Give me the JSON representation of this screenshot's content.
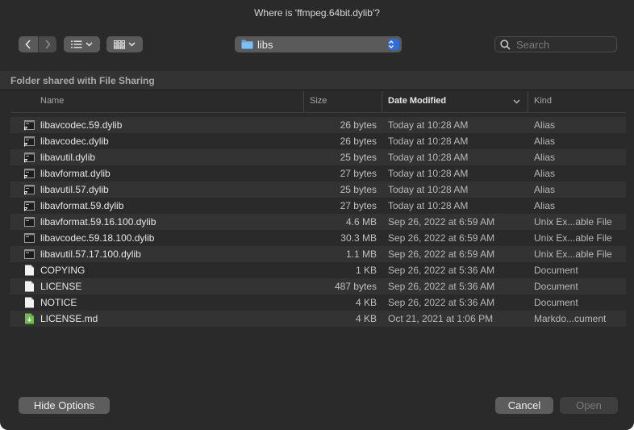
{
  "title": "Where is 'ffmpeg.64bit.dylib'?",
  "toolbar": {
    "folder_name": "libs",
    "search_placeholder": "Search"
  },
  "section_label": "Folder shared with File Sharing",
  "columns": {
    "name": "Name",
    "size": "Size",
    "date": "Date Modified",
    "kind": "Kind"
  },
  "files": [
    {
      "name": "libavcodec.59.dylib",
      "size": "26 bytes",
      "date": "Today at 10:28 AM",
      "kind": "Alias",
      "icon": "alias-exec-icon"
    },
    {
      "name": "libavcodec.dylib",
      "size": "26 bytes",
      "date": "Today at 10:28 AM",
      "kind": "Alias",
      "icon": "alias-exec-icon"
    },
    {
      "name": "libavutil.dylib",
      "size": "25 bytes",
      "date": "Today at 10:28 AM",
      "kind": "Alias",
      "icon": "alias-exec-icon"
    },
    {
      "name": "libavformat.dylib",
      "size": "27 bytes",
      "date": "Today at 10:28 AM",
      "kind": "Alias",
      "icon": "alias-exec-icon"
    },
    {
      "name": "libavutil.57.dylib",
      "size": "25 bytes",
      "date": "Today at 10:28 AM",
      "kind": "Alias",
      "icon": "alias-exec-icon"
    },
    {
      "name": "libavformat.59.dylib",
      "size": "27 bytes",
      "date": "Today at 10:28 AM",
      "kind": "Alias",
      "icon": "alias-exec-icon"
    },
    {
      "name": "libavformat.59.16.100.dylib",
      "size": "4.6 MB",
      "date": "Sep 26, 2022 at 6:59 AM",
      "kind": "Unix Ex...able File",
      "icon": "exec-icon"
    },
    {
      "name": "libavcodec.59.18.100.dylib",
      "size": "30.3 MB",
      "date": "Sep 26, 2022 at 6:59 AM",
      "kind": "Unix Ex...able File",
      "icon": "exec-icon"
    },
    {
      "name": "libavutil.57.17.100.dylib",
      "size": "1.1 MB",
      "date": "Sep 26, 2022 at 6:59 AM",
      "kind": "Unix Ex...able File",
      "icon": "exec-icon"
    },
    {
      "name": "COPYING",
      "size": "1 KB",
      "date": "Sep 26, 2022 at 5:36 AM",
      "kind": "Document",
      "icon": "document-icon"
    },
    {
      "name": "LICENSE",
      "size": "487 bytes",
      "date": "Sep 26, 2022 at 5:36 AM",
      "kind": "Document",
      "icon": "document-icon"
    },
    {
      "name": "NOTICE",
      "size": "4 KB",
      "date": "Sep 26, 2022 at 5:36 AM",
      "kind": "Document",
      "icon": "document-icon"
    },
    {
      "name": "LICENSE.md",
      "size": "4 KB",
      "date": "Oct 21, 2021 at 1:06 PM",
      "kind": "Markdo...cument",
      "icon": "markdown-icon"
    }
  ],
  "buttons": {
    "hide_options": "Hide Options",
    "cancel": "Cancel",
    "open": "Open"
  },
  "colors": {
    "accent": "#2f6ed8",
    "folder": "#5aa9ee",
    "markdown": "#6cc04a"
  }
}
